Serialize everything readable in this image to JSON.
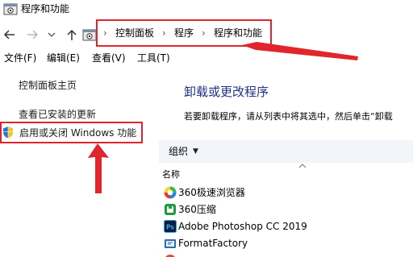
{
  "window": {
    "title": "程序和功能"
  },
  "breadcrumb": {
    "items": [
      "控制面板",
      "程序",
      "程序和功能"
    ],
    "separator": "›"
  },
  "menu": {
    "items": [
      "文件(F)",
      "编辑(E)",
      "查看(V)",
      "工具(T)"
    ]
  },
  "left_pane": {
    "home_link": "控制面板主页",
    "view_updates": "查看已安装的更新",
    "windows_features": "启用或关闭 Windows 功能"
  },
  "main": {
    "heading": "卸载或更改程序",
    "description": "若要卸载程序，请从列表中将其选中，然后单击“卸载",
    "organize_label": "组织",
    "column_name": "名称",
    "programs": [
      {
        "name": "360极速浏览器",
        "icon": "360-browser-icon"
      },
      {
        "name": "360压缩",
        "icon": "360-zip-icon"
      },
      {
        "name": "Adobe Photoshop CC 2019",
        "icon": "photoshop-icon"
      },
      {
        "name": "FormatFactory",
        "icon": "format-factory-icon"
      }
    ]
  },
  "colors": {
    "highlight": "#e0262c",
    "heading": "#1e3287",
    "toolbar_bg": "#f3f5fa"
  }
}
